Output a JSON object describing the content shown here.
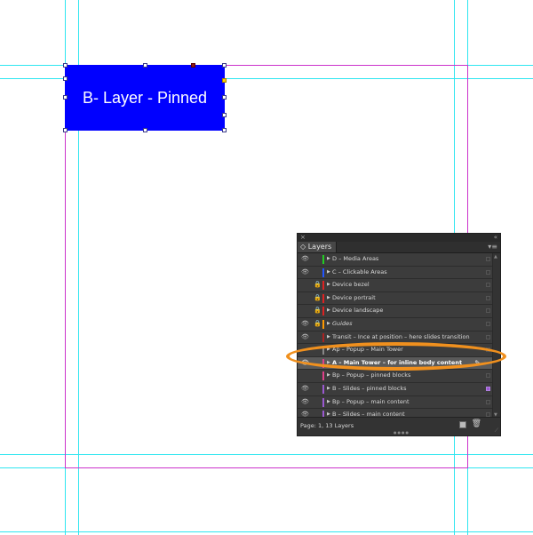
{
  "canvas": {
    "frame_label": "B- Layer - Pinned",
    "frame_color": "#0000ff",
    "guide_color": "#2ee6f0",
    "margin_color": "#cc33cc",
    "highlight_color": "#f0901e"
  },
  "layers_panel": {
    "close_glyph": "×",
    "collapse_glyph": "«",
    "tab_label": "Layers",
    "tab_glyph": "◇",
    "menu_glyph": "▾≡",
    "status": "Page: 1, 13 Layers",
    "layers": [
      {
        "name": "D – Media Areas",
        "color": "#22cc22",
        "visible": true,
        "locked": false,
        "italic": false,
        "selected": false,
        "target": false
      },
      {
        "name": "C – Clickable Areas",
        "color": "#2255ff",
        "visible": true,
        "locked": false,
        "italic": false,
        "selected": false,
        "target": false
      },
      {
        "name": "Device bezel",
        "color": "#dd2222",
        "visible": false,
        "locked": true,
        "italic": false,
        "selected": false,
        "target": false
      },
      {
        "name": "Device portrait",
        "color": "#dd2222",
        "visible": false,
        "locked": true,
        "italic": false,
        "selected": false,
        "target": false
      },
      {
        "name": "Device landscape",
        "color": "#dd2222",
        "visible": false,
        "locked": true,
        "italic": false,
        "selected": false,
        "target": false
      },
      {
        "name": "Guides",
        "color": "#ff9900",
        "visible": true,
        "locked": true,
        "italic": true,
        "selected": false,
        "target": false
      },
      {
        "name": "Transit – Ince at position – here slides transition",
        "color": "#aa2222",
        "visible": true,
        "locked": false,
        "italic": false,
        "selected": false,
        "target": false
      },
      {
        "name": "Ap – Popup – Main Tower",
        "color": "#888888",
        "visible": false,
        "locked": false,
        "italic": false,
        "selected": false,
        "target": false
      },
      {
        "name": "A – Main Tower – for inline body content",
        "color": "#e0408a",
        "visible": true,
        "locked": false,
        "italic": false,
        "selected": true,
        "target": false
      },
      {
        "name": "Bp – Popup – pinned blocks",
        "color": "#e0408a",
        "visible": false,
        "locked": false,
        "italic": false,
        "selected": false,
        "target": false
      },
      {
        "name": "B – Slides – pinned blocks",
        "color": "#9b59d0",
        "visible": true,
        "locked": false,
        "italic": false,
        "selected": false,
        "target": true
      },
      {
        "name": "Bp – Popup – main content",
        "color": "#9b59d0",
        "visible": true,
        "locked": false,
        "italic": false,
        "selected": false,
        "target": false
      },
      {
        "name": "B – Slides – main content",
        "color": "#9b59d0",
        "visible": true,
        "locked": false,
        "italic": false,
        "selected": false,
        "target": false
      }
    ]
  }
}
